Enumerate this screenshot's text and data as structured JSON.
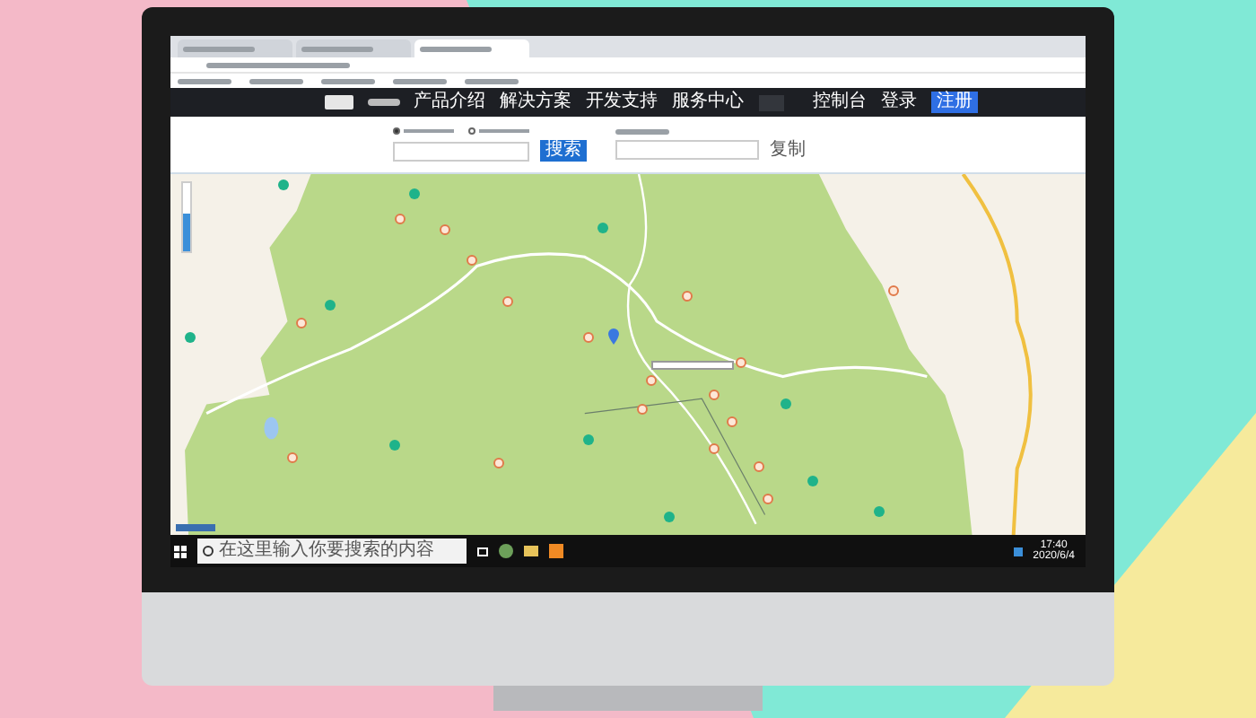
{
  "browser": {
    "tabs": [
      {
        "selected": false
      },
      {
        "selected": false
      },
      {
        "selected": true
      }
    ]
  },
  "navbar": {
    "items": [
      "产品介绍",
      "解决方案",
      "开发支持",
      "服务中心"
    ],
    "console": "控制台",
    "login": "登录",
    "register": "注册"
  },
  "form": {
    "options": [
      {
        "selected": true
      },
      {
        "selected": false
      }
    ],
    "search_button": "搜索",
    "copy_link": "复制"
  },
  "map": {
    "zoom": {
      "level": 0.55
    }
  },
  "taskbar": {
    "search_placeholder": "在这里输入你要搜索的内容",
    "time": "17:40",
    "date": "2020/6/4"
  }
}
